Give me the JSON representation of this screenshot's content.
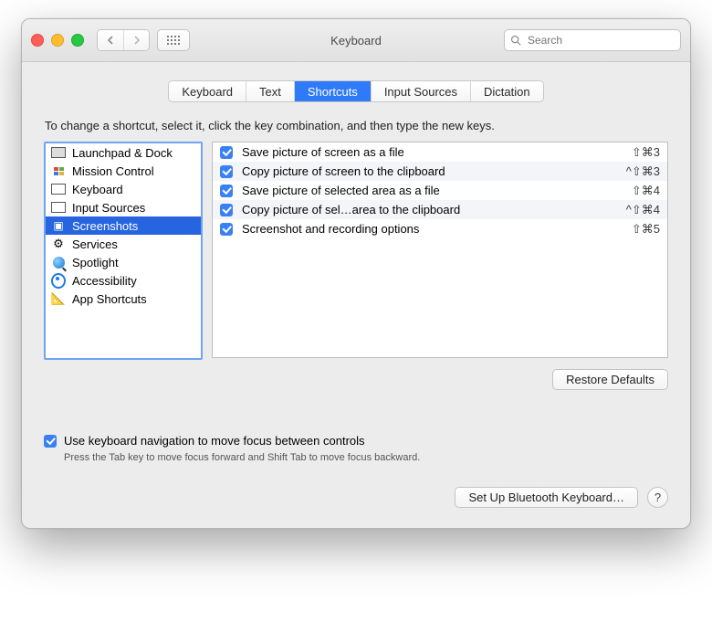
{
  "window": {
    "title": "Keyboard"
  },
  "search": {
    "placeholder": "Search"
  },
  "tabs": [
    "Keyboard",
    "Text",
    "Shortcuts",
    "Input Sources",
    "Dictation"
  ],
  "selected_tab_index": 2,
  "instruction": "To change a shortcut, select it, click the key combination, and then type the new keys.",
  "categories": [
    {
      "label": "Launchpad & Dock",
      "icon": "launchpad-icon"
    },
    {
      "label": "Mission Control",
      "icon": "mission-control-icon"
    },
    {
      "label": "Keyboard",
      "icon": "keyboard-icon"
    },
    {
      "label": "Input Sources",
      "icon": "input-sources-icon"
    },
    {
      "label": "Screenshots",
      "icon": "screenshots-icon"
    },
    {
      "label": "Services",
      "icon": "services-icon"
    },
    {
      "label": "Spotlight",
      "icon": "spotlight-icon"
    },
    {
      "label": "Accessibility",
      "icon": "accessibility-icon"
    },
    {
      "label": "App Shortcuts",
      "icon": "app-shortcuts-icon"
    }
  ],
  "selected_category_index": 4,
  "shortcuts": [
    {
      "enabled": true,
      "label": "Save picture of screen as a file",
      "keys": "⇧⌘3"
    },
    {
      "enabled": true,
      "label": "Copy picture of screen to the clipboard",
      "keys": "^⇧⌘3"
    },
    {
      "enabled": true,
      "label": "Save picture of selected area as a file",
      "keys": "⇧⌘4"
    },
    {
      "enabled": true,
      "label": "Copy picture of sel…area to the clipboard",
      "keys": "^⇧⌘4"
    },
    {
      "enabled": true,
      "label": "Screenshot and recording options",
      "keys": "⇧⌘5"
    }
  ],
  "restore_defaults_label": "Restore Defaults",
  "keyboard_nav": {
    "checked": true,
    "label": "Use keyboard navigation to move focus between controls",
    "sub": "Press the Tab key to move focus forward and Shift Tab to move focus backward."
  },
  "bluetooth_button": "Set Up Bluetooth Keyboard…",
  "help_label": "?"
}
